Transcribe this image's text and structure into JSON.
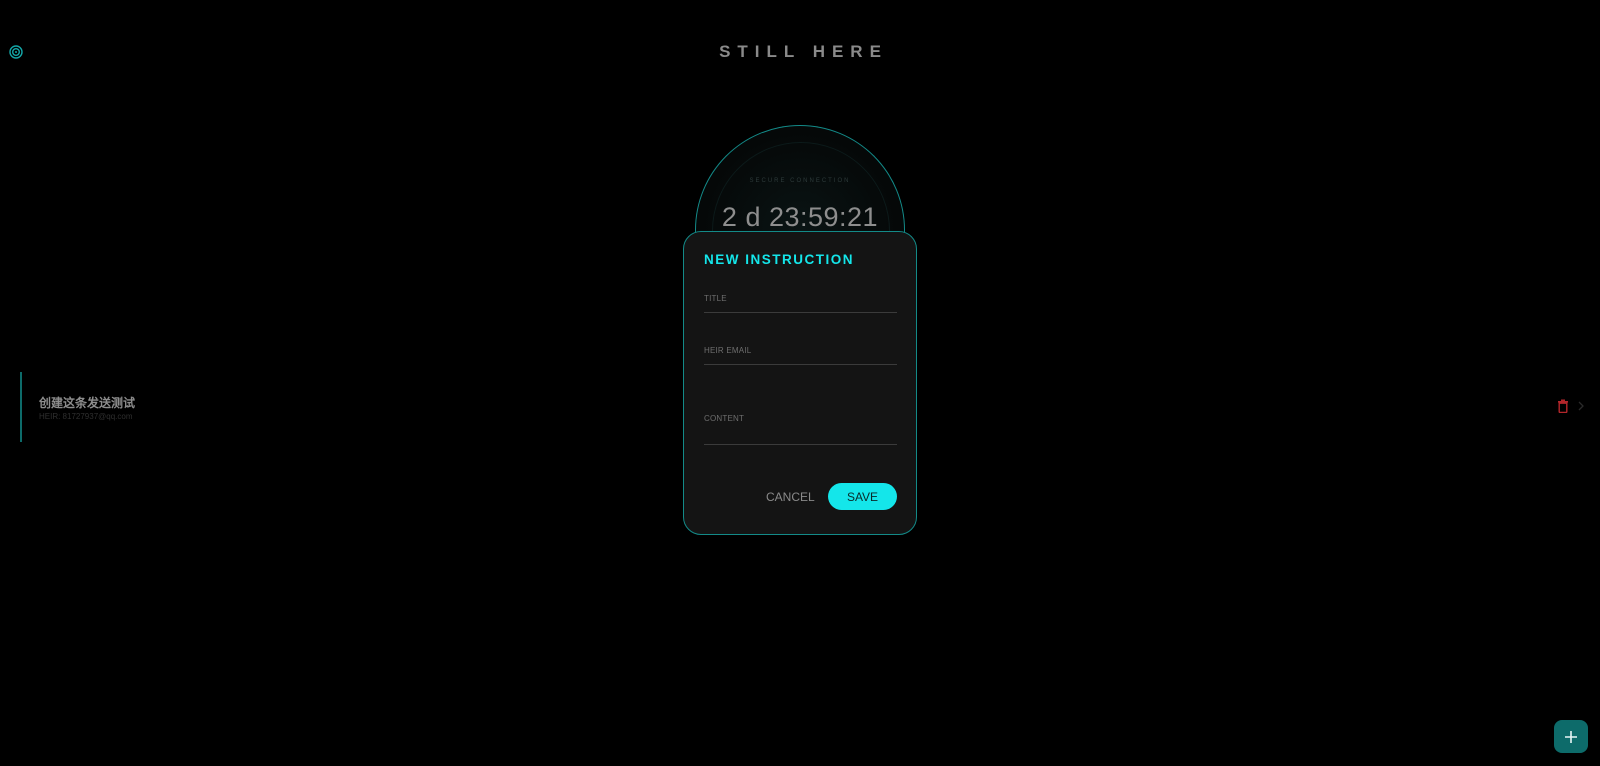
{
  "app": {
    "title": "STILL HERE",
    "logo_icon": "target-icon",
    "accent_color": "#14e6ea",
    "accent_dim_color": "#138a88"
  },
  "timer": {
    "label": "SECURE CONNECTION",
    "value": "2 d  23:59:21"
  },
  "instructions": [
    {
      "title": "创建这条发送测试",
      "heir": "HEIR: 81727937@qq.com",
      "delete_icon": "trash-icon",
      "open_icon": "chevron-right-icon",
      "delete_color": "#b3262b"
    }
  ],
  "modal": {
    "title": "NEW INSTRUCTION",
    "fields": {
      "title_label": "TITLE",
      "title_value": "",
      "email_label": "HEIR EMAIL",
      "email_value": "",
      "content_label": "CONTENT",
      "content_value": ""
    },
    "cancel_label": "CANCEL",
    "save_label": "SAVE"
  },
  "fab": {
    "icon": "plus-icon"
  }
}
